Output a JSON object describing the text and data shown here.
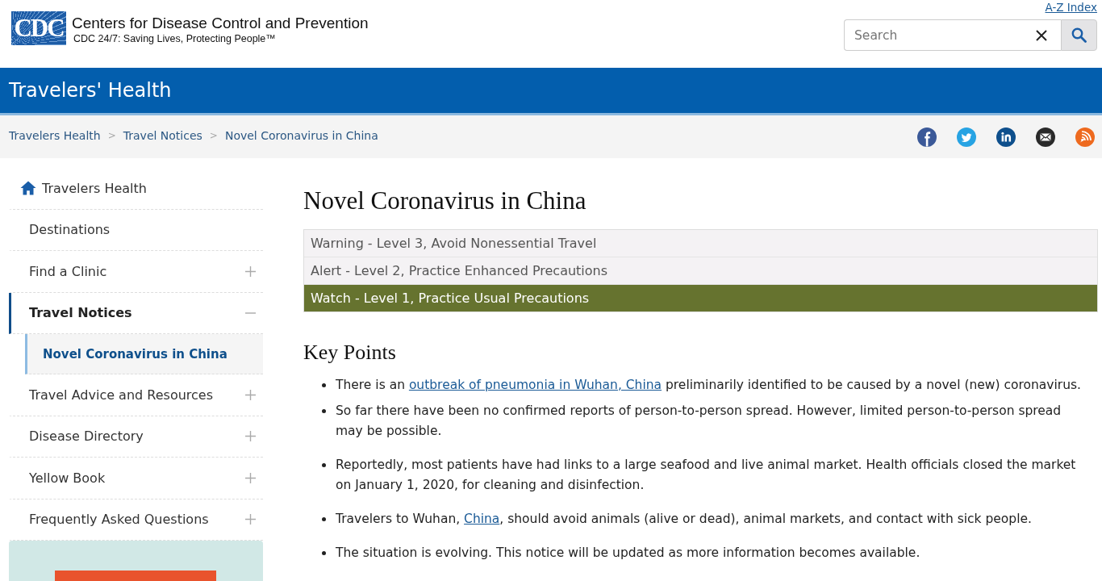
{
  "header": {
    "logo_text": "CDC",
    "org_name": "Centers for Disease Control and Prevention",
    "tagline": "CDC 24/7: Saving Lives, Protecting People™",
    "az_link": "A-Z Index",
    "search": {
      "placeholder": "Search"
    }
  },
  "banner": {
    "title": "Travelers' Health"
  },
  "breadcrumb": [
    {
      "kind": "link",
      "text": "Travelers Health"
    },
    {
      "kind": "separator",
      "text": ">"
    },
    {
      "kind": "link",
      "text": "Travel Notices"
    },
    {
      "kind": "separator",
      "text": ">"
    },
    {
      "kind": "link",
      "text": "Novel Coronavirus in China"
    }
  ],
  "sidebar": {
    "items": [
      {
        "kind": "home",
        "label": "Travelers Health",
        "selected": false
      },
      {
        "kind": "plain",
        "label": "Destinations",
        "selected": false
      },
      {
        "kind": "toggle",
        "label": "Find a Clinic",
        "selected": false,
        "expanded": false
      },
      {
        "kind": "toggle",
        "label": "Travel Notices",
        "selected": true,
        "expanded": true,
        "children": [
          {
            "label": "Novel Coronavirus in China",
            "selected": true
          }
        ]
      },
      {
        "kind": "toggle",
        "label": "Travel Advice and Resources",
        "selected": false,
        "expanded": false
      },
      {
        "kind": "toggle",
        "label": "Disease Directory",
        "selected": false,
        "expanded": false
      },
      {
        "kind": "toggle",
        "label": "Yellow Book",
        "selected": false,
        "expanded": false
      },
      {
        "kind": "toggle",
        "label": "Frequently Asked Questions",
        "selected": false,
        "expanded": false
      }
    ]
  },
  "main": {
    "title": "Novel Coronavirus in China",
    "levels": [
      {
        "label": "Warning - Level 3, Avoid Nonessential Travel",
        "selected": false
      },
      {
        "label": "Alert - Level 2, Practice Enhanced Precautions",
        "selected": false
      },
      {
        "label": "Watch - Level 1, Practice Usual Precautions",
        "selected": true
      }
    ],
    "key_points": {
      "heading": "Key Points",
      "items": [
        [
          {
            "kind": "text",
            "text": "There is an "
          },
          {
            "kind": "link",
            "text": "outbreak of pneumonia in Wuhan, China"
          },
          {
            "kind": "text",
            "text": " preliminarily identified to be caused by a novel (new) coronavirus."
          }
        ],
        [
          {
            "kind": "text",
            "text": "So far there have been no confirmed reports of person-to-person spread. However, limited person-to-person spread may be possible."
          }
        ],
        [
          {
            "kind": "text",
            "text": "Reportedly, most patients have had links to a large seafood and live animal market. Health officials closed the market on January 1, 2020, for cleaning and disinfection."
          }
        ],
        [
          {
            "kind": "text",
            "text": "Travelers to Wuhan, "
          },
          {
            "kind": "link",
            "text": "China"
          },
          {
            "kind": "text",
            "text": ", should avoid animals (alive or dead), animal markets, and contact with sick people."
          }
        ],
        [
          {
            "kind": "text",
            "text": "The situation is evolving. This notice will be updated as more information becomes available."
          }
        ]
      ]
    }
  }
}
